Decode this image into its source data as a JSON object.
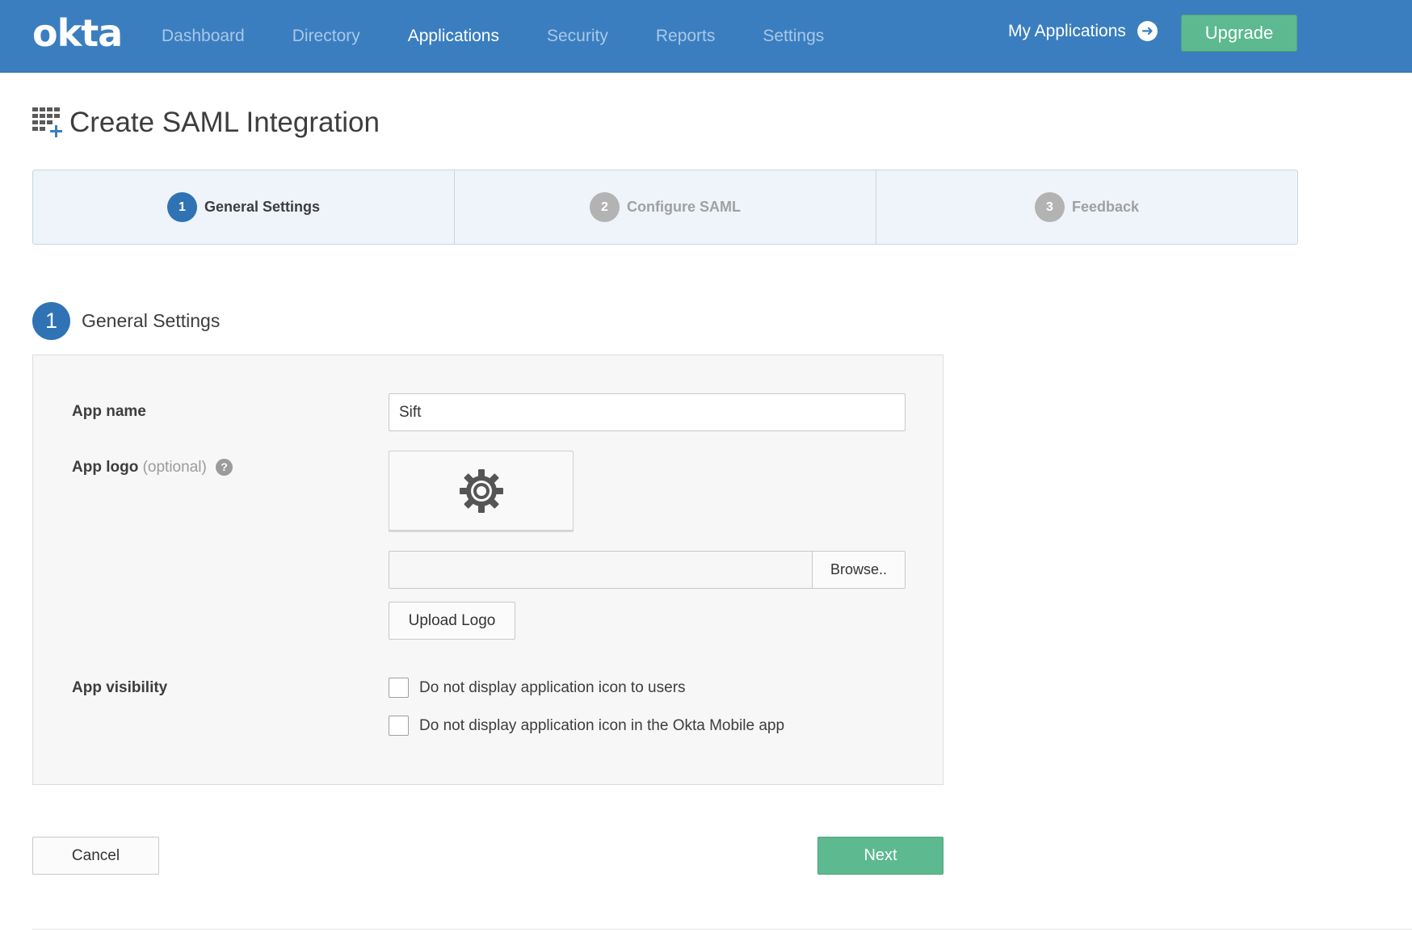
{
  "brand": {
    "logo_text": "okta",
    "header_bg": "#3a7ebf",
    "accent_green": "#5cb990",
    "step_active": "#2f73b5"
  },
  "nav": {
    "items": [
      {
        "label": "Dashboard",
        "active": false
      },
      {
        "label": "Directory",
        "active": false
      },
      {
        "label": "Applications",
        "active": true
      },
      {
        "label": "Security",
        "active": false
      },
      {
        "label": "Reports",
        "active": false
      },
      {
        "label": "Settings",
        "active": false
      }
    ],
    "my_applications": "My Applications",
    "upgrade": "Upgrade"
  },
  "page": {
    "title": "Create SAML Integration",
    "title_icon": "grid-plus-icon"
  },
  "wizard": {
    "steps": [
      {
        "num": "1",
        "label": "General Settings",
        "active": true
      },
      {
        "num": "2",
        "label": "Configure SAML",
        "active": false
      },
      {
        "num": "3",
        "label": "Feedback",
        "active": false
      }
    ]
  },
  "section": {
    "num": "1",
    "title": "General Settings"
  },
  "form": {
    "app_name_label": "App name",
    "app_name_value": "Sift",
    "app_logo_label": "App logo",
    "app_logo_optional": "(optional)",
    "help_glyph": "?",
    "logo_placeholder_icon": "gear-icon",
    "file_path_value": "",
    "browse_label": "Browse..",
    "upload_label": "Upload Logo",
    "visibility_label": "App visibility",
    "visibility_options": [
      {
        "label": "Do not display application icon to users",
        "checked": false
      },
      {
        "label": "Do not display application icon in the Okta Mobile app",
        "checked": false
      }
    ]
  },
  "actions": {
    "cancel": "Cancel",
    "next": "Next"
  }
}
